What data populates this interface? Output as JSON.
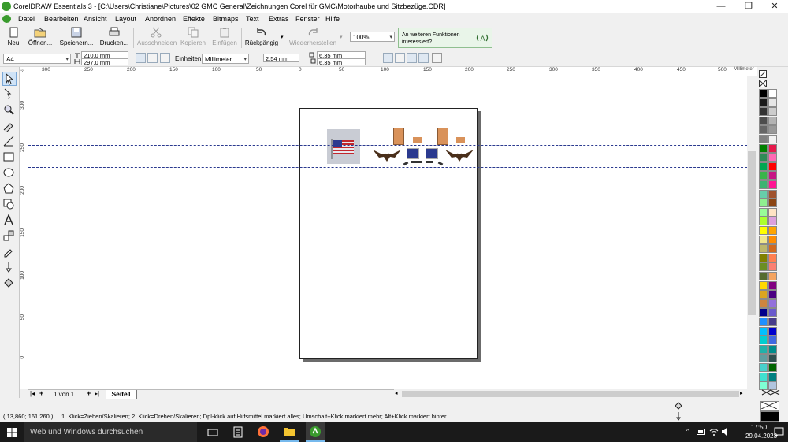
{
  "window": {
    "title": "CorelDRAW Essentials 3 - [C:\\Users\\Christiane\\Pictures\\02 GMC General\\Zeichnungen Corel für GMC\\Motorhaube und Sitzbezüge.CDR]",
    "minimize": "—",
    "maximize": "❐",
    "close": "✕"
  },
  "menu": [
    "Datei",
    "Bearbeiten",
    "Ansicht",
    "Layout",
    "Anordnen",
    "Effekte",
    "Bitmaps",
    "Text",
    "Extras",
    "Fenster",
    "Hilfe"
  ],
  "toolbar": {
    "new": "Neu",
    "open": "Öffnen...",
    "save": "Speichern...",
    "print": "Drucken...",
    "cut": "Ausschneiden",
    "copy": "Kopieren",
    "paste": "Einfügen",
    "undo": "Rückgängig",
    "redo": "Wiederherstellen",
    "zoom": "100%",
    "help_text": "An weiteren Funktionen interessiert?"
  },
  "propbar": {
    "page_size": "A4",
    "width": "210,0 mm",
    "height": "297,0 mm",
    "units_label": "Einheiten:",
    "units": "Millimeter",
    "nudge": "2,54 mm",
    "dup_x": "6,35 mm",
    "dup_y": "6,35 mm"
  },
  "ruler": {
    "unit": "Millimeter",
    "top_ticks": [
      "300",
      "250",
      "200",
      "150",
      "100",
      "50",
      "0",
      "50",
      "100",
      "150",
      "200",
      "250",
      "300",
      "350",
      "400",
      "450",
      "500"
    ],
    "left_ticks": [
      "300",
      "250",
      "200",
      "150",
      "100",
      "50",
      "0"
    ]
  },
  "pages": {
    "counter": "1 von 1",
    "tab": "Seite1"
  },
  "status": {
    "coords": "( 13,860; 161,260 )",
    "hint": "1. Klick=Ziehen/Skalieren; 2. Klick=Drehen/Skalieren; Dpl-klick auf Hilfsmittel markiert alles; Umschalt+Klick markiert mehr; Alt+Klick markiert hinter..."
  },
  "taskbar": {
    "search": "Web und Windows durchsuchen",
    "time": "17:50",
    "date": "29.04.2023"
  },
  "palette": {
    "colors": [
      "#000000",
      "#ffffff",
      "#1a1a1a",
      "#e6e6e6",
      "#333333",
      "#cccccc",
      "#4d4d4d",
      "#b3b3b3",
      "#666666",
      "#999999",
      "#808080",
      "#f2f2f2",
      "#008000",
      "#e6194b",
      "#2e8b57",
      "#ff69b4",
      "#00a651",
      "#ff0000",
      "#39b54a",
      "#c71585",
      "#3cb371",
      "#ff1493",
      "#66cdaa",
      "#a0522d",
      "#90ee90",
      "#8b4513",
      "#98fb98",
      "#ffe4c4",
      "#adff2f",
      "#dda0dd",
      "#ffff00",
      "#ffa500",
      "#f0e68c",
      "#ff8c00",
      "#bdb76b",
      "#d2691e",
      "#808000",
      "#ff7f50",
      "#6b8e23",
      "#fa8072",
      "#556b2f",
      "#f4a460",
      "#ffd700",
      "#800080",
      "#daa520",
      "#4b0082",
      "#cd853f",
      "#9370db",
      "#00008b",
      "#6a5acd",
      "#1e90ff",
      "#483d8b",
      "#00bfff",
      "#0000cd",
      "#00ced1",
      "#4169e1",
      "#20b2aa",
      "#008b8b",
      "#5f9ea0",
      "#2f4f4f",
      "#48d1cc",
      "#006400",
      "#40e0d0",
      "#008080",
      "#7fffd4",
      "#b0c4de"
    ]
  }
}
